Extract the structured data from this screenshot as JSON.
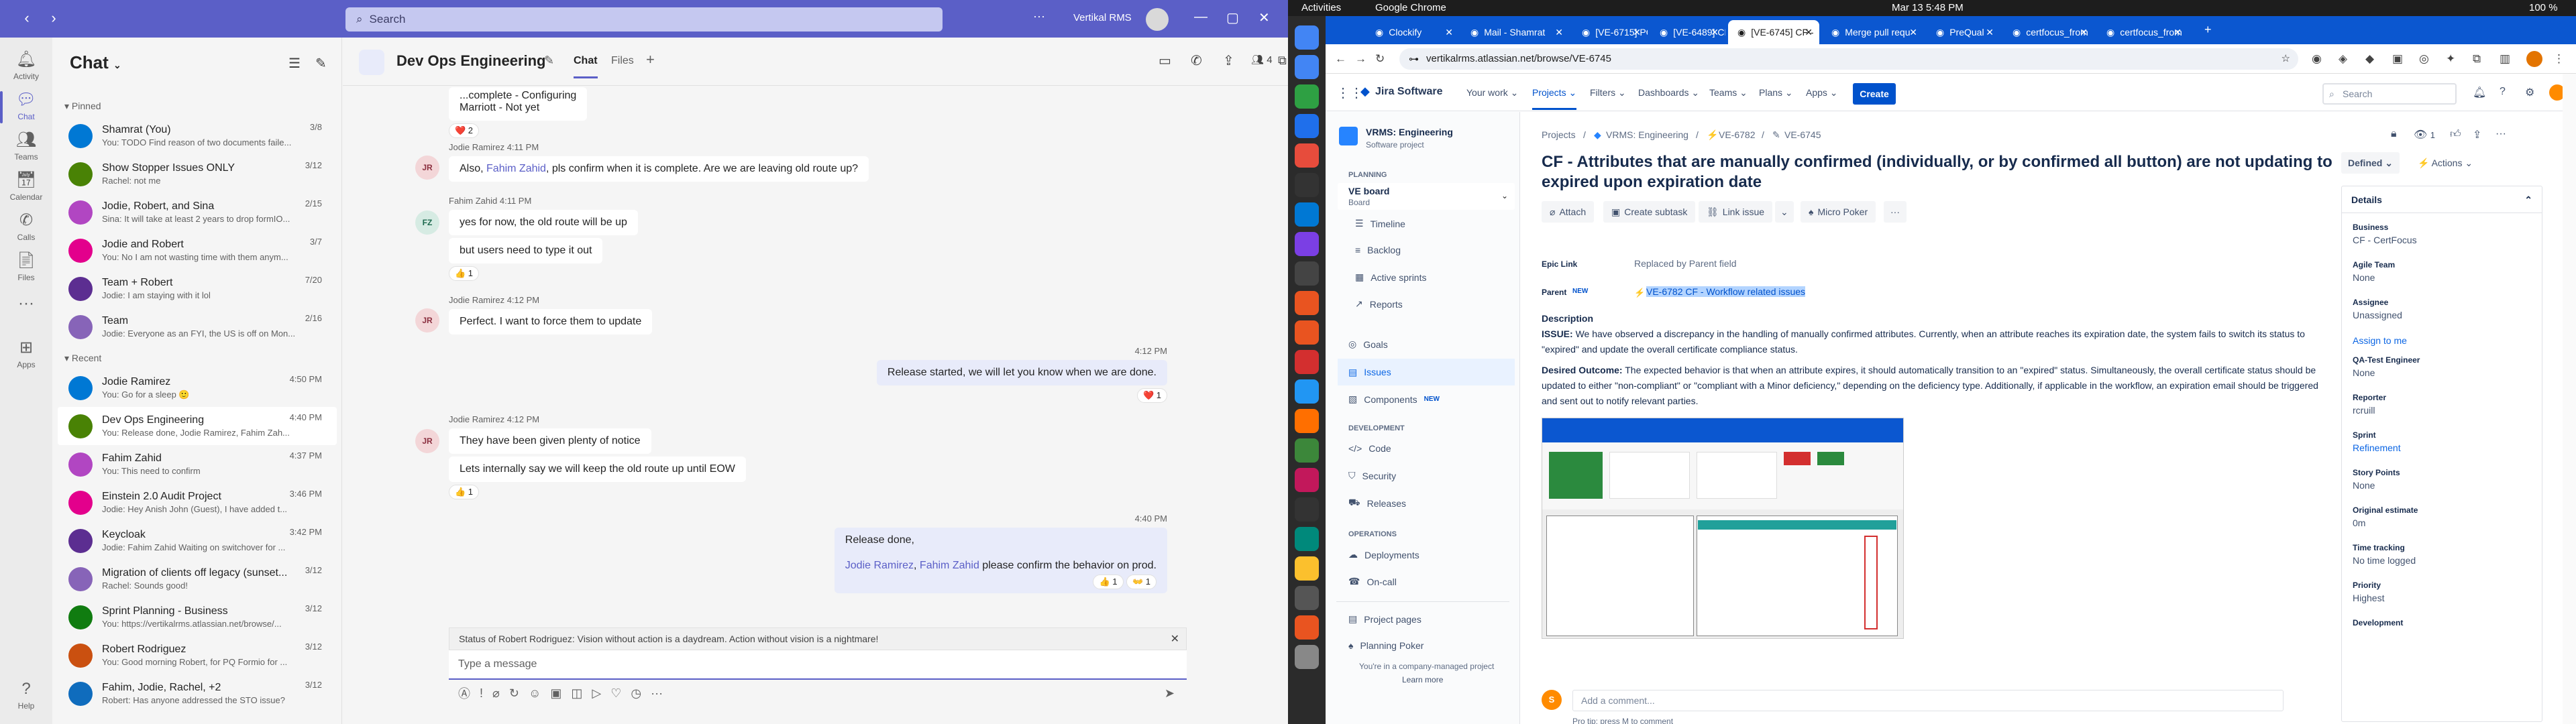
{
  "teams": {
    "search_placeholder": "Search",
    "org": "Vertikal RMS",
    "rail": [
      {
        "label": "Activity",
        "icon": "bell-icon"
      },
      {
        "label": "Chat",
        "icon": "chat-icon"
      },
      {
        "label": "Teams",
        "icon": "teams-icon"
      },
      {
        "label": "Calendar",
        "icon": "calendar-icon"
      },
      {
        "label": "Calls",
        "icon": "phone-icon"
      },
      {
        "label": "Files",
        "icon": "file-icon"
      },
      {
        "label": "Apps",
        "icon": "apps-icon"
      },
      {
        "label": "Help",
        "icon": "help-icon"
      }
    ],
    "list_title": "Chat",
    "pinned_label": "Pinned",
    "recent_label": "Recent",
    "pinned": [
      {
        "name": "Shamrat (You)",
        "time": "3/8",
        "preview": "You: TODO Find reason of two documents faile..."
      },
      {
        "name": "Show Stopper Issues ONLY",
        "time": "3/12",
        "preview": "Rachel: not me"
      },
      {
        "name": "Jodie, Robert, and Sina",
        "time": "2/15",
        "preview": "Sina: It will take at least 2 years to drop formIO..."
      },
      {
        "name": "Jodie and Robert",
        "time": "3/7",
        "preview": "You: No I am not wasting time with them anym..."
      },
      {
        "name": "Team + Robert",
        "time": "7/20",
        "preview": "Jodie: I am staying with it lol"
      },
      {
        "name": "Team",
        "time": "2/16",
        "preview": "Jodie: Everyone as an FYI, the US is off on Mon..."
      }
    ],
    "recent": [
      {
        "name": "Jodie Ramirez",
        "time": "4:50 PM",
        "preview": "You: Go for a sleep 🙂"
      },
      {
        "name": "Dev Ops Engineering",
        "time": "4:40 PM",
        "preview": "You: Release done, Jodie Ramirez, Fahim Zah..."
      },
      {
        "name": "Fahim Zahid",
        "time": "4:37 PM",
        "preview": "You: This need to confirm"
      },
      {
        "name": "Einstein 2.0 Audit Project",
        "time": "3:46 PM",
        "preview": "Jodie: Hey Anish John (Guest), I have added t..."
      },
      {
        "name": "Keycloak",
        "time": "3:42 PM",
        "preview": "Jodie: Fahim Zahid Waiting on switchover for ..."
      },
      {
        "name": "Migration of clients off legacy (sunset...",
        "time": "3/12",
        "preview": "Rachel: Sounds good!"
      },
      {
        "name": "Sprint Planning - Business",
        "time": "3/12",
        "preview": "You: https://vertikalrms.atlassian.net/browse/..."
      },
      {
        "name": "Robert Rodriguez",
        "time": "3/12",
        "preview": "You: Good morning Robert, for PQ Formio for ..."
      },
      {
        "name": "Fahim, Jodie, Rachel, +2",
        "time": "3/12",
        "preview": "Robert: Has anyone addressed the STO issue?"
      }
    ],
    "chat_title": "Dev Ops Engineering",
    "chat_tabs": [
      "Chat",
      "Files"
    ],
    "participants": "4",
    "messages": {
      "top_frag1": "...complete - Configuring",
      "top_frag2": "Marriott - Not yet",
      "r_heart_2": "❤️ 2",
      "m1_meta": "Jodie Ramirez  4:11 PM",
      "m1_pre": "Also, ",
      "m1_mention": "Fahim Zahid",
      "m1_post": ", pls confirm when it is complete.  Are we are leaving old route up?",
      "m2_meta": "Fahim Zahid  4:11 PM",
      "m2_a": "yes for now, the old route will be up",
      "m2_b": "but users need to type it out",
      "r_thumb_1": "👍 1",
      "m3_meta": "Jodie Ramirez  4:12 PM",
      "m3": "Perfect.  I want to force them to update",
      "m4_time": "4:12 PM",
      "m4": "Release started, we will let you know when we are done.",
      "r_heart_1": "❤️ 1",
      "m5_meta": "Jodie Ramirez  4:12 PM",
      "m5_a": "They have been given plenty of notice",
      "m5_b": "Lets internally say we will keep the old route up until EOW",
      "r_thumb_1b": "👍 1",
      "m6_time": "4:40 PM",
      "m6_a": "Release done,",
      "m6_m1": "Jodie Ramirez",
      "m6_sep": ", ",
      "m6_m2": "Fahim Zahid",
      "m6_post": " please confirm the behavior on prod.",
      "r_m6a": "👍 1",
      "r_m6b": "👐 1"
    },
    "status_bar": "Status of Robert Rodriguez: Vision without action is a daydream. Action without vision is a nightmare!",
    "compose_placeholder": "Type a message",
    "avatar_initials": {
      "jr": "JR",
      "fz": "FZ"
    }
  },
  "ubuntu": {
    "activities": "Activities",
    "app": "Google Chrome",
    "clock": "Mar 13  5:48 PM",
    "battery": "100 %"
  },
  "chrome": {
    "tabs": [
      "Clockify",
      "Mail - Shamrat",
      "[VE-6715] PQ -",
      "[VE-6489] CF W",
      "[VE-6745] CF -",
      "Merge pull requ",
      "PreQual",
      "certfocus_from",
      "certfocus_from"
    ],
    "url": "vertikalrms.atlassian.net/browse/VE-6745"
  },
  "jira": {
    "product": "Jira Software",
    "nav": [
      "Your work ⌄",
      "Projects ⌄",
      "Filters ⌄",
      "Dashboards ⌄",
      "Teams ⌄",
      "Plans ⌄",
      "Apps ⌄"
    ],
    "create": "Create",
    "search_placeholder": "Search",
    "project_name": "VRMS: Engineering",
    "project_type": "Software project",
    "planning_label": "PLANNING",
    "board_name": "VE board",
    "board_sub": "Board",
    "planning_items": [
      "Timeline",
      "Backlog",
      "Active sprints",
      "Reports"
    ],
    "other_items": [
      "Goals",
      "Issues",
      "Components"
    ],
    "new_badge": "NEW",
    "development_label": "DEVELOPMENT",
    "dev_items": [
      "Code",
      "Security",
      "Releases"
    ],
    "operations_label": "OPERATIONS",
    "ops_items": [
      "Deployments",
      "On-call"
    ],
    "bottom_items": [
      "Project pages",
      "Planning Poker"
    ],
    "managed_note": "You're in a company-managed project",
    "learn_more": "Learn more",
    "breadcrumbs": [
      "Projects",
      "VRMS: Engineering",
      "VE-6782",
      "VE-6745"
    ],
    "title": "CF - Attributes that are manually confirmed (individually, or by confirmed all button) are not updating to expired upon expiration date",
    "actions": [
      "Attach",
      "Create subtask",
      "Link issue",
      "Micro Poker"
    ],
    "epic_link_label": "Epic Link",
    "epic_link_value": "Replaced by Parent field",
    "parent_label": "Parent",
    "parent_new": "NEW",
    "parent_value": "VE-6782 CF - Workflow related issues",
    "description_label": "Description",
    "issue_label": "ISSUE:",
    "issue_text": " We have observed a discrepancy in the handling of manually confirmed attributes. Currently, when an attribute reaches its expiration date, the system fails to switch its status to \"expired\" and update the overall certificate compliance status.",
    "outcome_label": "Desired Outcome:",
    "outcome_text": " The expected behavior is that when an attribute expires, it should automatically transition to an \"expired\" status. Simultaneously, the overall certificate status should be updated to either \"non-compliant\" or \"compliant with a Minor deficiency,\" depending on the deficiency type. Additionally, if applicable in the workflow, an expiration email should be triggered and sent out to notify relevant parties.",
    "comment_placeholder": "Add a comment...",
    "comment_avatar": "S",
    "pro_tip": "Pro tip: press M to comment",
    "status": "Defined ⌄",
    "actions_btn": "Actions ⌄",
    "watchers": "1",
    "details_label": "Details",
    "fields": [
      {
        "label": "Business",
        "value": "CF - CertFocus",
        "link": false
      },
      {
        "label": "Agile Team",
        "value": "None",
        "link": false
      },
      {
        "label": "Assignee",
        "value": "Unassigned",
        "link": false
      },
      {
        "label": "",
        "value": "Assign to me",
        "link": true
      },
      {
        "label": "QA-Test Engineer",
        "value": "None",
        "link": false
      },
      {
        "label": "Reporter",
        "value": "rcruill",
        "link": false
      },
      {
        "label": "Sprint",
        "value": "Refinement",
        "link": true
      },
      {
        "label": "Story Points",
        "value": "None",
        "link": false
      },
      {
        "label": "Original estimate",
        "value": "0m",
        "link": false
      },
      {
        "label": "Time tracking",
        "value": "No time logged",
        "link": false
      },
      {
        "label": "Priority",
        "value": "Highest",
        "link": false
      },
      {
        "label": "Development",
        "value": "",
        "link": false
      }
    ]
  },
  "colors": {
    "teams_brand": "#5b5fc7",
    "chrome_tab_bar": "#0b57d0",
    "jira_blue": "#0052cc"
  }
}
